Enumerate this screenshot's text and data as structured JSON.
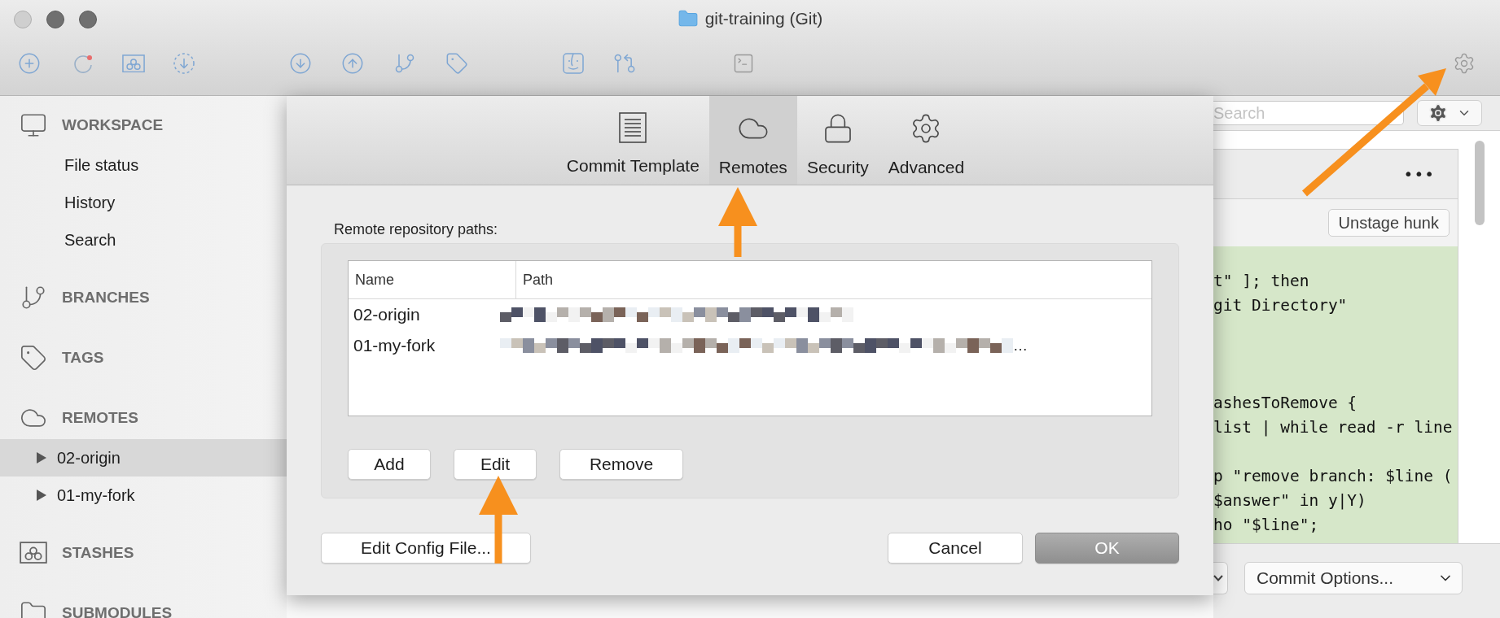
{
  "window": {
    "title": "git-training (Git)"
  },
  "sidebar": {
    "sections": [
      {
        "title": "WORKSPACE",
        "items": [
          {
            "label": "File status",
            "selected": false
          },
          {
            "label": "History",
            "selected": false
          },
          {
            "label": "Search",
            "selected": false
          }
        ]
      },
      {
        "title": "BRANCHES"
      },
      {
        "title": "TAGS"
      },
      {
        "title": "REMOTES",
        "items": [
          {
            "label": "02-origin",
            "selected": true,
            "expanded": false
          },
          {
            "label": "01-my-fork",
            "selected": false,
            "expanded": false
          }
        ]
      },
      {
        "title": "STASHES"
      },
      {
        "title": "SUBMODULES"
      }
    ]
  },
  "dialog": {
    "tabs": [
      {
        "label": "Commit Template",
        "selected": false
      },
      {
        "label": "Remotes",
        "selected": true
      },
      {
        "label": "Security",
        "selected": false
      },
      {
        "label": "Advanced",
        "selected": false
      }
    ],
    "paths_label": "Remote repository paths:",
    "table": {
      "columns": [
        "Name",
        "Path"
      ],
      "rows": [
        {
          "name": "02-origin",
          "path_redacted": true
        },
        {
          "name": "01-my-fork",
          "path_redacted": true,
          "path_end": "…"
        }
      ]
    },
    "row_buttons": [
      "Add",
      "Edit",
      "Remove"
    ],
    "config_button": "Edit Config File...",
    "buttons": [
      {
        "label": "Cancel",
        "default": false
      },
      {
        "label": "OK",
        "default": true
      }
    ]
  },
  "right_pane": {
    "search": {
      "placeholder": "Search"
    },
    "more": "•••",
    "unstage_button": "Unstage hunk",
    "code_blocks": [
      [
        "t\" ]; then",
        "git Directory\""
      ],
      [
        "ashesToRemove {",
        "list | while read -r line"
      ],
      [
        "p \"remove branch: $line (",
        "$answer\" in y|Y)",
        "ho \"$line\";"
      ]
    ],
    "commit_options": "Commit Options..."
  }
}
